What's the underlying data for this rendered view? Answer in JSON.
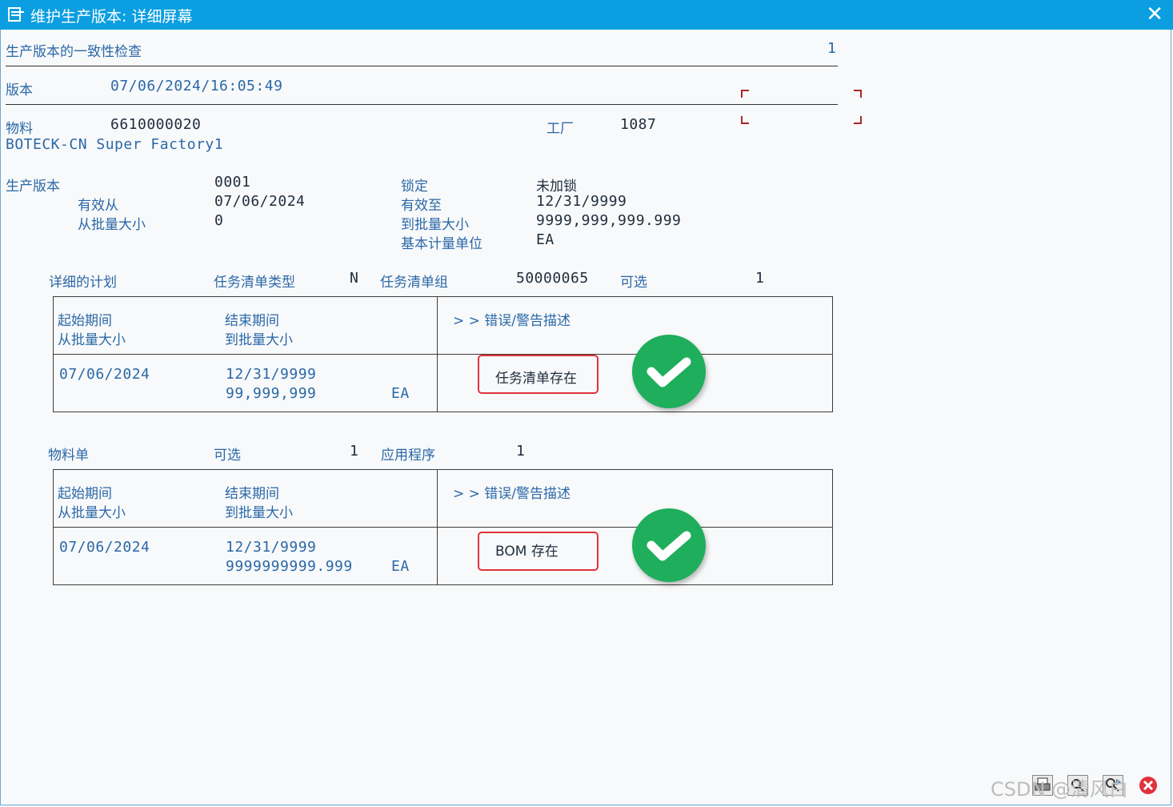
{
  "window": {
    "title": "维护生产版本: 详细屏幕",
    "close_label": "✕"
  },
  "header": {
    "check_title": "生产版本的一致性检查",
    "page_number": "1",
    "version_label": "版本",
    "version_value": "07/06/2024/16:05:49"
  },
  "material": {
    "label": "物料",
    "value": "6610000020",
    "description": "BOTECK-CN Super Factory1",
    "plant_label": "工厂",
    "plant_value": "1087"
  },
  "production_version": {
    "label": "生产版本",
    "value": "0001",
    "lock_label": "锁定",
    "lock_value": "未加锁",
    "valid_from_label": "有效从",
    "valid_from_value": "07/06/2024",
    "valid_to_label": "有效至",
    "valid_to_value": "12/31/9999",
    "from_lot_label": "从批量大小",
    "from_lot_value": "0",
    "to_lot_label": "到批量大小",
    "to_lot_value": "9999,999,999.999",
    "base_uom_label": "基本计量单位",
    "base_uom_value": "EA"
  },
  "routing_section": {
    "title": "详细的计划",
    "type_label": "任务清单类型",
    "type_value": "N",
    "group_label": "任务清单组",
    "group_value": "50000065",
    "alt_label": "可选",
    "alt_value": "1",
    "table": {
      "h_start": "起始期间",
      "h_from_lot": "从批量大小",
      "h_end": "结束期间",
      "h_to_lot": "到批量大小",
      "h_msg": "> > 错误/警告描述",
      "r_start": "07/06/2024",
      "r_end": "12/31/9999",
      "r_to_lot": "99,999,999",
      "r_uom": "EA",
      "r_msg": "任务清单存在"
    }
  },
  "bom_section": {
    "title": "物料单",
    "alt_label": "可选",
    "alt_value": "1",
    "app_label": "应用程序",
    "app_value": "1",
    "table": {
      "h_start": "起始期间",
      "h_from_lot": "从批量大小",
      "h_end": "结束期间",
      "h_to_lot": "到批量大小",
      "h_msg": "> > 错误/警告描述",
      "r_start": "07/06/2024",
      "r_end": "12/31/9999",
      "r_to_lot": "9999999999.999",
      "r_uom": "EA",
      "r_msg": "BOM 存在"
    }
  },
  "watermark": "CSDN @清风白",
  "colors": {
    "titlebar": "#0b9ee0",
    "label_blue": "#2a68a8",
    "highlight_red": "#e0323d",
    "check_green": "#1fae5c"
  },
  "icons": [
    "document-icon",
    "close-icon",
    "checkmark-icon",
    "checkmark-icon",
    "print-icon",
    "find-icon",
    "find-next-icon",
    "cancel-icon"
  ]
}
